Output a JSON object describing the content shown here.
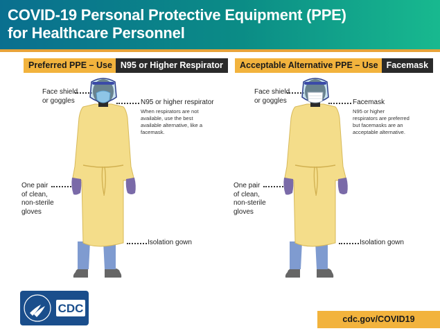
{
  "header": {
    "title_line1": "COVID-19 Personal Protective Equipment (PPE)",
    "title_line2": "for Healthcare Personnel",
    "accent_color": "#e8a33a",
    "gradient_colors": [
      "#0a6f8f",
      "#18b98f"
    ]
  },
  "preferred": {
    "tag": "Preferred PPE – Use",
    "device": "N95 or Higher Respirator",
    "face_shield": [
      "Face shield",
      "or goggles"
    ],
    "mask_label": "N95 or higher respirator",
    "mask_note": [
      "When respirators are not",
      "available, use the best",
      "available alternative, like a",
      "facemask."
    ],
    "gloves": [
      "One pair",
      "of clean,",
      "non-sterile",
      "gloves"
    ],
    "gown": "Isolation gown"
  },
  "alternative": {
    "tag": "Acceptable Alternative PPE – Use",
    "device": "Facemask",
    "face_shield": [
      "Face shield",
      "or goggles"
    ],
    "mask_label": "Facemask",
    "mask_note": [
      "N95 or higher",
      "respirators are preferred",
      "but facemasks are an",
      "acceptable alternative."
    ],
    "gloves": [
      "One pair",
      "of clean,",
      "non-sterile",
      "gloves"
    ],
    "gown": "Isolation gown"
  },
  "footer": {
    "logo_text": "CDC",
    "url": "cdc.gov/COVID19"
  },
  "colors": {
    "gown": "#f4dd8a",
    "gloves": "#7a6aa8",
    "mask_n95": "#8ec5e6",
    "mask_facemask": "#ffffff",
    "pants": "#7f9bd0",
    "shoes": "#666666",
    "logo_blue": "#1a4e8c"
  }
}
